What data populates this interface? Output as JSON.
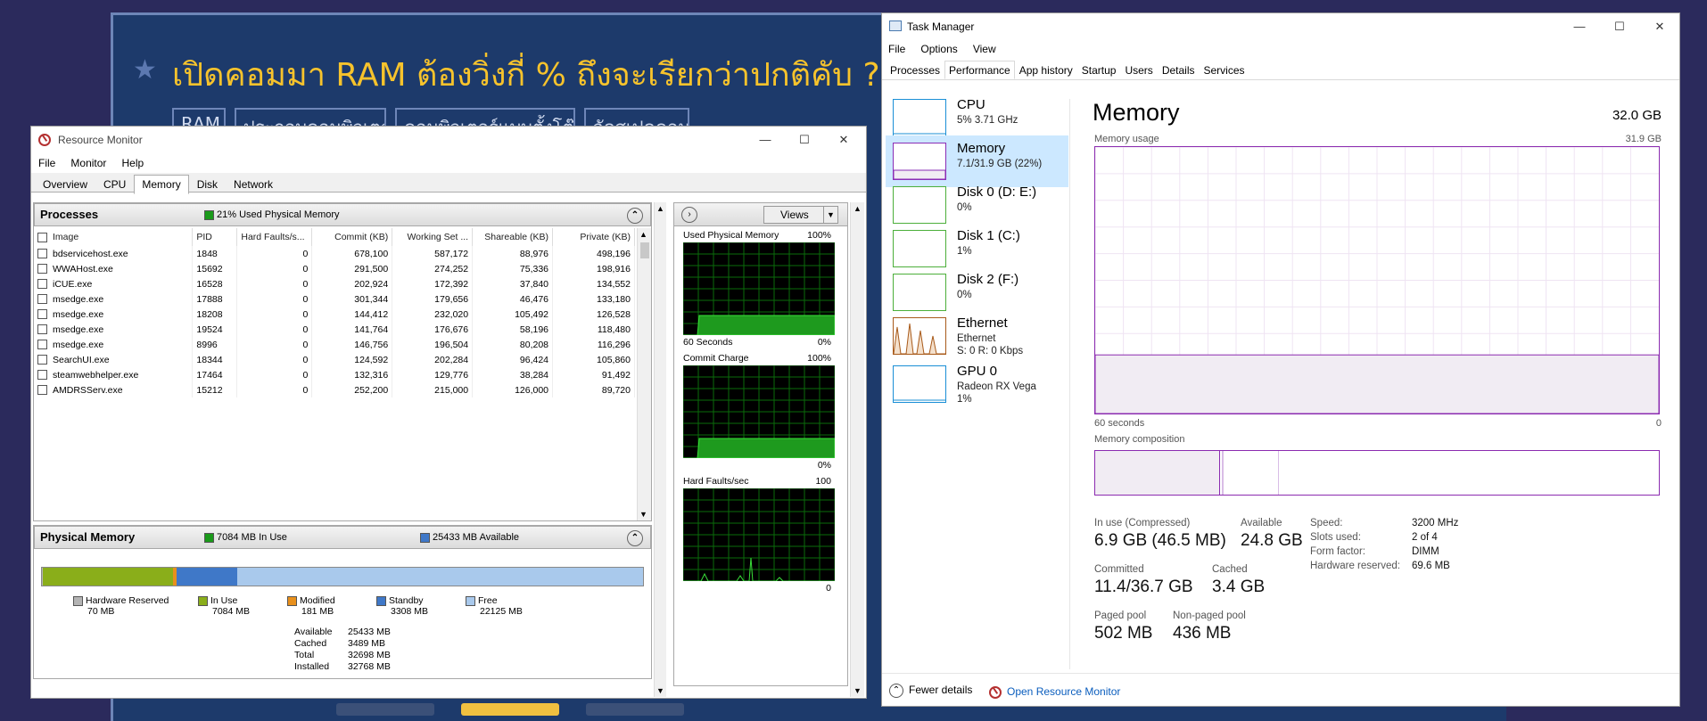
{
  "background_page": {
    "title": "เปิดคอมมา RAM ต้องวิ่งกี่ % ถึงจะเรียกว่าปกติคับ ?",
    "tags": [
      "RAM",
      "ประกอบคอมพิวเตอร์",
      "คอมพิวเตอร์แบบตั้งโต๊ะ",
      "จัดสเปคคอม"
    ]
  },
  "resource_monitor": {
    "title": "Resource Monitor",
    "menu": [
      "File",
      "Monitor",
      "Help"
    ],
    "tabs": [
      "Overview",
      "CPU",
      "Memory",
      "Disk",
      "Network"
    ],
    "active_tab": "Memory",
    "processes": {
      "header": "Processes",
      "status": "21% Used Physical Memory",
      "columns": [
        "Image",
        "PID",
        "Hard Faults/s...",
        "Commit (KB)",
        "Working Set ...",
        "Shareable (KB)",
        "Private (KB)"
      ],
      "rows": [
        [
          "bdservicehost.exe",
          "1848",
          "0",
          "678,100",
          "587,172",
          "88,976",
          "498,196"
        ],
        [
          "WWAHost.exe",
          "15692",
          "0",
          "291,500",
          "274,252",
          "75,336",
          "198,916"
        ],
        [
          "iCUE.exe",
          "16528",
          "0",
          "202,924",
          "172,392",
          "37,840",
          "134,552"
        ],
        [
          "msedge.exe",
          "17888",
          "0",
          "301,344",
          "179,656",
          "46,476",
          "133,180"
        ],
        [
          "msedge.exe",
          "18208",
          "0",
          "144,412",
          "232,020",
          "105,492",
          "126,528"
        ],
        [
          "msedge.exe",
          "19524",
          "0",
          "141,764",
          "176,676",
          "58,196",
          "118,480"
        ],
        [
          "msedge.exe",
          "8996",
          "0",
          "146,756",
          "196,504",
          "80,208",
          "116,296"
        ],
        [
          "SearchUI.exe",
          "18344",
          "0",
          "124,592",
          "202,284",
          "96,424",
          "105,860"
        ],
        [
          "steamwebhelper.exe",
          "17464",
          "0",
          "132,316",
          "129,776",
          "38,284",
          "91,492"
        ],
        [
          "AMDRSServ.exe",
          "15212",
          "0",
          "252,200",
          "215,000",
          "126,000",
          "89,720"
        ]
      ]
    },
    "physical_memory": {
      "header": "Physical Memory",
      "in_use_label": "7084 MB In Use",
      "available_label": "25433 MB Available",
      "bar": {
        "hardware_reserved_mb": 70,
        "in_use_mb": 7084,
        "modified_mb": 181,
        "standby_mb": 3308,
        "free_mb": 22125
      },
      "legend": [
        {
          "name": "Hardware Reserved",
          "value": "70 MB",
          "color": "#b4b4b4"
        },
        {
          "name": "In Use",
          "value": "7084 MB",
          "color": "#8aae1a"
        },
        {
          "name": "Modified",
          "value": "181 MB",
          "color": "#e8901c"
        },
        {
          "name": "Standby",
          "value": "3308 MB",
          "color": "#3f78c8"
        },
        {
          "name": "Free",
          "value": "22125 MB",
          "color": "#a9c9ec"
        }
      ],
      "summary": [
        [
          "Available",
          "25433 MB"
        ],
        [
          "Cached",
          "3489 MB"
        ],
        [
          "Total",
          "32698 MB"
        ],
        [
          "Installed",
          "32768 MB"
        ]
      ]
    },
    "side_panel": {
      "views_label": "Views",
      "graphs": [
        {
          "title": "Used Physical Memory",
          "max": "100%",
          "footer_left": "60 Seconds",
          "footer_right": "0%"
        },
        {
          "title": "Commit Charge",
          "max": "100%",
          "footer_left": "",
          "footer_right": "0%"
        },
        {
          "title": "Hard Faults/sec",
          "max": "100",
          "footer_left": "",
          "footer_right": "0"
        }
      ]
    }
  },
  "task_manager": {
    "title": "Task Manager",
    "menu": [
      "File",
      "Options",
      "View"
    ],
    "tabs": [
      "Processes",
      "Performance",
      "App history",
      "Startup",
      "Users",
      "Details",
      "Services"
    ],
    "active_tab": "Performance",
    "sidebar": [
      {
        "name": "CPU",
        "sub1": "5% 3.71 GHz",
        "sub2": "",
        "sub3": "",
        "color": "#1a8fd6"
      },
      {
        "name": "Memory",
        "sub1": "7.1/31.9 GB (22%)",
        "sub2": "",
        "sub3": "",
        "color": "#8a2db5"
      },
      {
        "name": "Disk 0 (D: E:)",
        "sub1": "0%",
        "sub2": "",
        "sub3": "",
        "color": "#4caf3a"
      },
      {
        "name": "Disk 1 (C:)",
        "sub1": "1%",
        "sub2": "",
        "sub3": "",
        "color": "#4caf3a"
      },
      {
        "name": "Disk 2 (F:)",
        "sub1": "0%",
        "sub2": "",
        "sub3": "",
        "color": "#4caf3a"
      },
      {
        "name": "Ethernet",
        "sub1": "Ethernet",
        "sub2": "S: 0 R: 0 Kbps",
        "sub3": "",
        "color": "#a85a1a"
      },
      {
        "name": "GPU 0",
        "sub1": "Radeon RX Vega",
        "sub2": "1%",
        "sub3": "",
        "color": "#1a8fd6"
      }
    ],
    "memory": {
      "heading": "Memory",
      "capacity": "32.0 GB",
      "usage_label": "Memory usage",
      "usage_max": "31.9 GB",
      "x_left": "60 seconds",
      "x_right": "0",
      "usage_percent": 22,
      "composition_label": "Memory composition",
      "stats": [
        {
          "label": "In use (Compressed)",
          "value": "6.9 GB (46.5 MB)"
        },
        {
          "label": "Available",
          "value": "24.8 GB"
        },
        {
          "label": "Committed",
          "value": "11.4/36.7 GB"
        },
        {
          "label": "Cached",
          "value": "3.4 GB"
        },
        {
          "label": "Paged pool",
          "value": "502 MB"
        },
        {
          "label": "Non-paged pool",
          "value": "436 MB"
        }
      ],
      "details": [
        [
          "Speed:",
          "3200 MHz"
        ],
        [
          "Slots used:",
          "2 of 4"
        ],
        [
          "Form factor:",
          "DIMM"
        ],
        [
          "Hardware reserved:",
          "69.6 MB"
        ]
      ]
    },
    "footer": {
      "fewer_details": "Fewer details",
      "open_resource_monitor": "Open Resource Monitor"
    }
  }
}
